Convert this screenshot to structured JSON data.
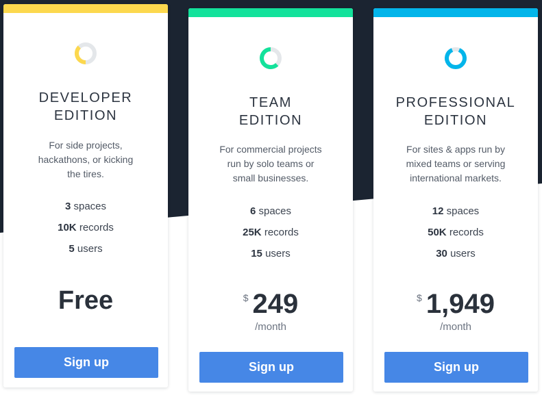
{
  "colors": {
    "page_bg": "#ffffff",
    "dark_bg": "#1b2431",
    "developer_accent": "#fcd84e",
    "team_accent": "#13e29b",
    "professional_accent": "#03b5ea",
    "button": "#4687e6"
  },
  "plans": [
    {
      "name_line1": "DEVELOPER",
      "name_line2": "EDITION",
      "description": [
        "For side projects,",
        "hackathons, or kicking",
        "the tires."
      ],
      "features": [
        {
          "value": "3",
          "unit": "spaces"
        },
        {
          "value": "10K",
          "unit": "records"
        },
        {
          "value": "5",
          "unit": "users"
        }
      ],
      "price": "Free",
      "button": "Sign up",
      "icon": "developer-ring-icon"
    },
    {
      "name_line1": "TEAM",
      "name_line2": "EDITION",
      "description": [
        "For commercial projects",
        "run by solo teams or",
        "small businesses."
      ],
      "features": [
        {
          "value": "6",
          "unit": "spaces"
        },
        {
          "value": "25K",
          "unit": "records"
        },
        {
          "value": "15",
          "unit": "users"
        }
      ],
      "currency": "$",
      "price": "249",
      "period": "/month",
      "button": "Sign up",
      "icon": "team-ring-icon"
    },
    {
      "name_line1": "PROFESSIONAL",
      "name_line2": "EDITION",
      "description": [
        "For sites & apps run by",
        "mixed teams or serving",
        "international markets."
      ],
      "features": [
        {
          "value": "12",
          "unit": "spaces"
        },
        {
          "value": "50K",
          "unit": "records"
        },
        {
          "value": "30",
          "unit": "users"
        }
      ],
      "currency": "$",
      "price": "1,949",
      "period": "/month",
      "button": "Sign up",
      "icon": "professional-ring-icon"
    }
  ]
}
